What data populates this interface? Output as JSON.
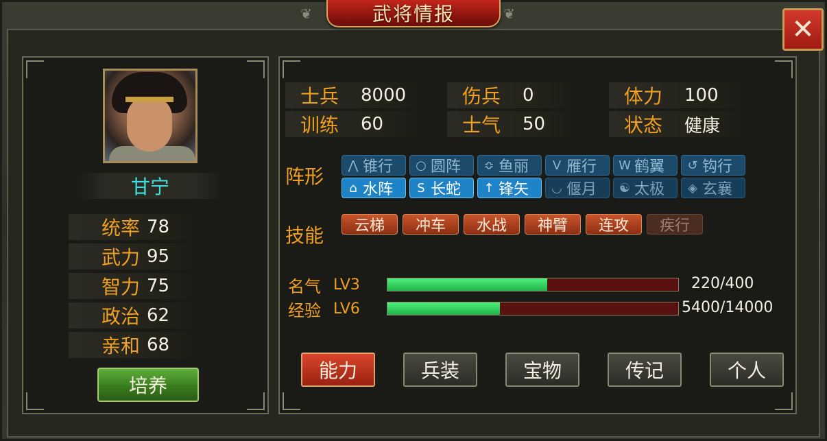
{
  "window": {
    "title": "武将情报"
  },
  "general": {
    "name": "甘宁",
    "stats": [
      {
        "label": "统率",
        "value": "78"
      },
      {
        "label": "武力",
        "value": "95"
      },
      {
        "label": "智力",
        "value": "75"
      },
      {
        "label": "政治",
        "value": "62"
      },
      {
        "label": "亲和",
        "value": "68"
      }
    ],
    "train_button": "培养"
  },
  "info": {
    "top_stats": [
      {
        "label": "士兵",
        "value": "8000"
      },
      {
        "label": "伤兵",
        "value": "0"
      },
      {
        "label": "体力",
        "value": "100"
      },
      {
        "label": "训练",
        "value": "60"
      },
      {
        "label": "士气",
        "value": "50"
      },
      {
        "label": "状态",
        "value": "健康"
      }
    ],
    "formation_label": "阵形",
    "formations": [
      {
        "label": "锥行",
        "icon": "arrow-up-icon",
        "state": "dim"
      },
      {
        "label": "圆阵",
        "icon": "circle-icon",
        "state": "dim"
      },
      {
        "label": "鱼丽",
        "icon": "double-chevron-icon",
        "state": "dim"
      },
      {
        "label": "雁行",
        "icon": "v-shape-icon",
        "state": "dim"
      },
      {
        "label": "鹤翼",
        "icon": "wings-icon",
        "state": "dim"
      },
      {
        "label": "钩行",
        "icon": "hook-icon",
        "state": "dim"
      },
      {
        "label": "水阵",
        "icon": "house-icon",
        "state": "on"
      },
      {
        "label": "长蛇",
        "icon": "snake-icon",
        "state": "on"
      },
      {
        "label": "锋矢",
        "icon": "arrow-icon",
        "state": "on"
      },
      {
        "label": "偃月",
        "icon": "crescent-icon",
        "state": "dim2"
      },
      {
        "label": "太极",
        "icon": "taiji-icon",
        "state": "dim2"
      },
      {
        "label": "玄襄",
        "icon": "diamond-icon",
        "state": "dim2"
      }
    ],
    "skill_label": "技能",
    "skills": [
      {
        "label": "云梯",
        "state": "on"
      },
      {
        "label": "冲车",
        "state": "on"
      },
      {
        "label": "水战",
        "state": "on"
      },
      {
        "label": "神臂",
        "state": "on"
      },
      {
        "label": "连攻",
        "state": "on"
      },
      {
        "label": "疾行",
        "state": "off"
      }
    ],
    "fame": {
      "label": "名气",
      "level": "LV3",
      "text": "220/400",
      "current": 220,
      "max": 400
    },
    "exp": {
      "label": "经验",
      "level": "LV6",
      "text": "5400/14000",
      "current": 5400,
      "max": 14000
    }
  },
  "tabs": [
    {
      "label": "能力",
      "active": true
    },
    {
      "label": "兵装",
      "active": false
    },
    {
      "label": "宝物",
      "active": false
    },
    {
      "label": "传记",
      "active": false
    },
    {
      "label": "个人",
      "active": false
    }
  ],
  "close_icon": "close-icon",
  "colors": {
    "accent": "#f0a020",
    "name": "#3ee0e0",
    "bar": "#1fb34a"
  }
}
